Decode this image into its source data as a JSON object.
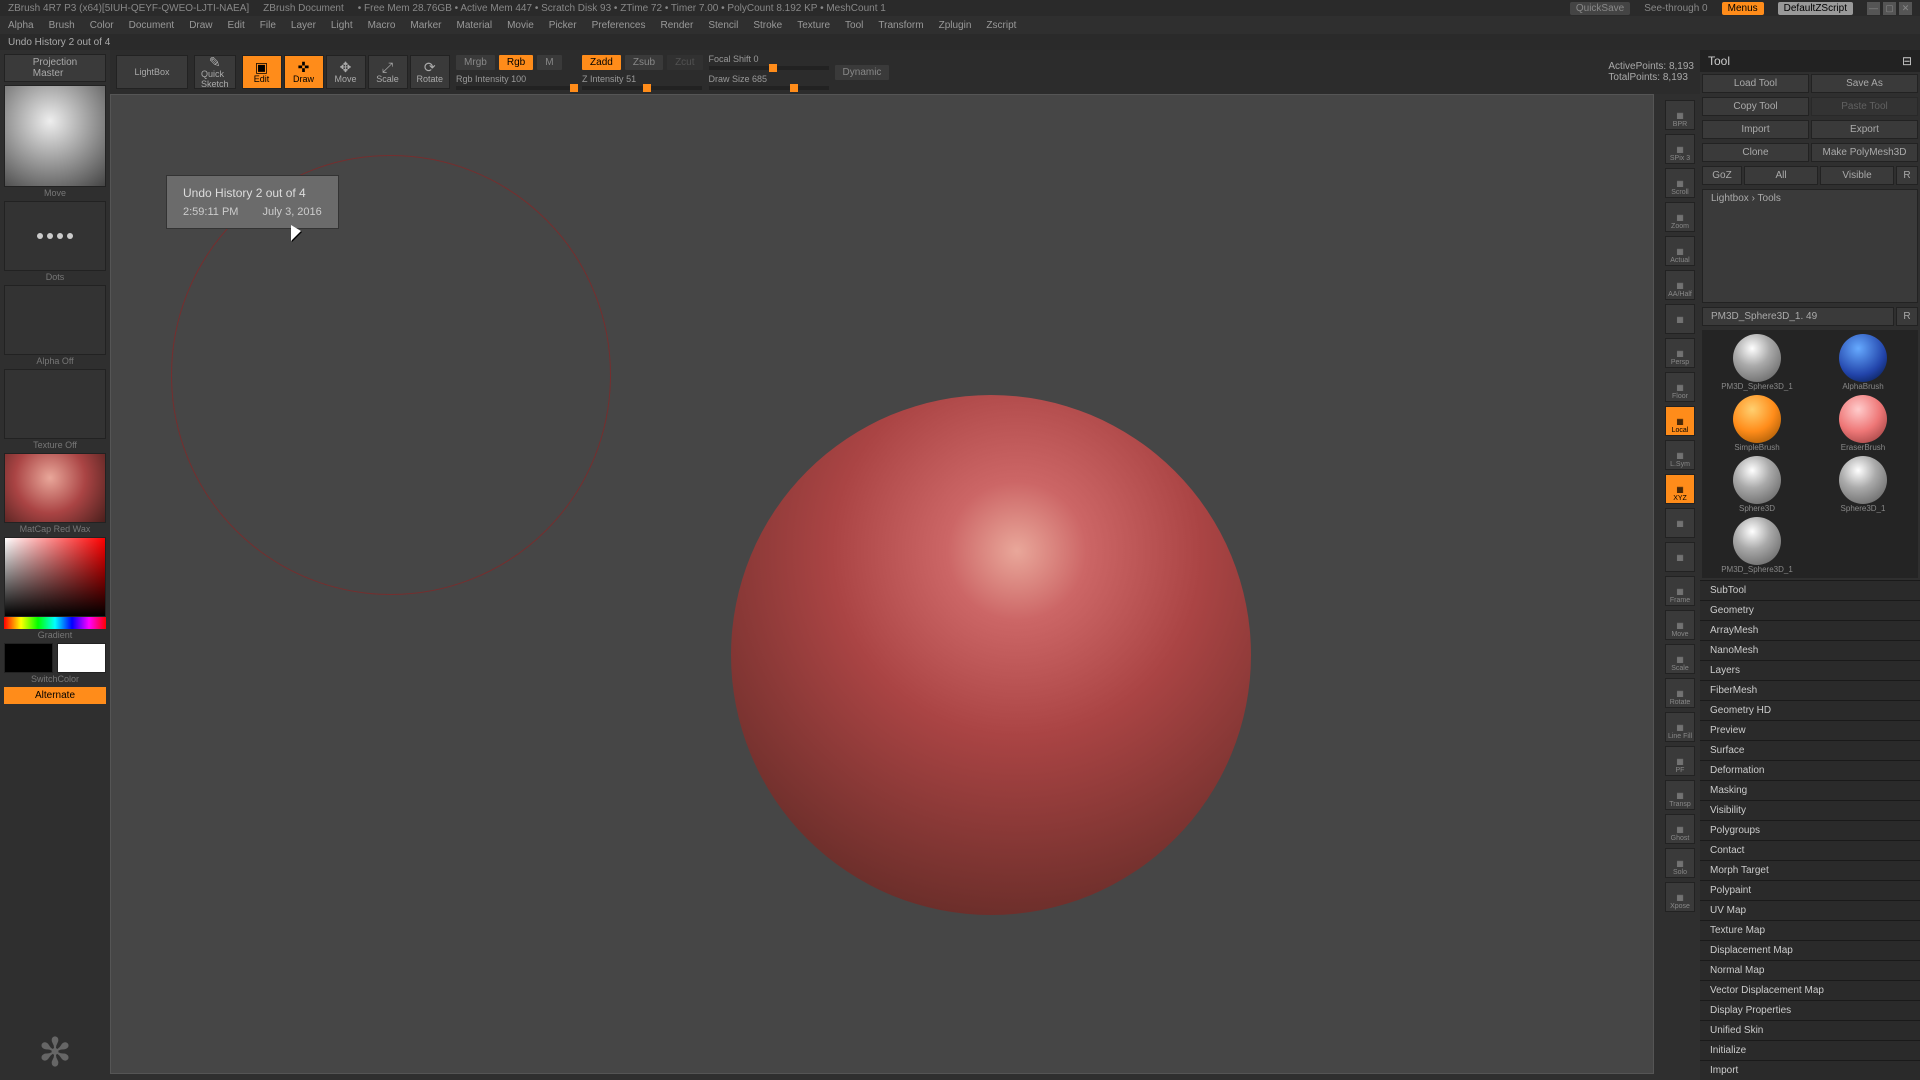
{
  "titlebar": {
    "app": "ZBrush 4R7 P3 (x64)[5IUH-QEYF-QWEO-LJTI-NAEA]",
    "doc": "ZBrush Document",
    "stats": "• Free Mem 28.76GB • Active Mem 447 • Scratch Disk 93 • ZTime 72 • Timer 7.00 • PolyCount 8.192 KP • MeshCount 1",
    "quicksave": "QuickSave",
    "seethrough": "See-through  0",
    "menus": "Menus",
    "script": "DefaultZScript"
  },
  "menubar": [
    "Alpha",
    "Brush",
    "Color",
    "Document",
    "Draw",
    "Edit",
    "File",
    "Layer",
    "Light",
    "Macro",
    "Marker",
    "Material",
    "Movie",
    "Picker",
    "Preferences",
    "Render",
    "Stencil",
    "Stroke",
    "Texture",
    "Tool",
    "Transform",
    "Zplugin",
    "Zscript"
  ],
  "undoline": "Undo History 2 out of 4",
  "left": {
    "proj": "Projection\nMaster",
    "lightbox": "LightBox",
    "brush_lbl": "Move",
    "stroke_lbl": "Dots",
    "alpha_lbl": "Alpha Off",
    "texture_lbl": "Texture Off",
    "material_lbl": "MatCap Red Wax",
    "gradient": "Gradient",
    "switchcolor": "SwitchColor",
    "alternate": "Alternate"
  },
  "topbar": {
    "quicksketch": "Quick\nSketch",
    "edit": "Edit",
    "draw": "Draw",
    "move": "Move",
    "scale": "Scale",
    "rotate": "Rotate",
    "mrgb": "Mrgb",
    "rgb": "Rgb",
    "m": "M",
    "rgb_intensity": "Rgb Intensity 100",
    "zadd": "Zadd",
    "zsub": "Zsub",
    "zcut": "Zcut",
    "z_intensity": "Z Intensity 51",
    "focal_shift": "Focal Shift 0",
    "draw_size": "Draw Size 685",
    "dynamic": "Dynamic",
    "active_points": "ActivePoints: 8,193",
    "total_points": "TotalPoints: 8,193"
  },
  "tooltip": {
    "title": "Undo History 2 out of 4",
    "time": "2:59:11 PM",
    "date": "July 3, 2016"
  },
  "iconstrip": [
    "BPR",
    "SPix 3",
    "Scroll",
    "Zoom",
    "Actual",
    "AA/Half",
    "",
    "Persp",
    "Floor",
    "Local",
    "L.Sym",
    "XYZ",
    "",
    "",
    "Frame",
    "Move",
    "Scale",
    "Rotate",
    "Line Fill",
    "PF",
    "Transp",
    "Ghost",
    "Solo",
    "Xpose"
  ],
  "right": {
    "title": "Tool",
    "buttons": {
      "load": "Load Tool",
      "save": "Save As",
      "copy": "Copy Tool",
      "paste": "Paste Tool",
      "import": "Import",
      "export": "Export",
      "clone": "Clone",
      "polymesh": "Make PolyMesh3D",
      "goz": "GoZ",
      "all": "All",
      "visible": "Visible",
      "r": "R"
    },
    "lightbox_tools": "Lightbox › Tools",
    "current_name": "PM3D_Sphere3D_1. 49",
    "tools": [
      {
        "name": "PM3D_Sphere3D_1",
        "cls": ""
      },
      {
        "name": "AlphaBrush",
        "cls": "alpha"
      },
      {
        "name": "SimpleBrush",
        "cls": "simple"
      },
      {
        "name": "EraserBrush",
        "cls": "eraser"
      },
      {
        "name": "Sphere3D",
        "cls": ""
      },
      {
        "name": "Sphere3D_1",
        "cls": ""
      },
      {
        "name": "PM3D_Sphere3D_1",
        "cls": ""
      }
    ],
    "sections": [
      "SubTool",
      "Geometry",
      "ArrayMesh",
      "NanoMesh",
      "Layers",
      "FiberMesh",
      "Geometry HD",
      "Preview",
      "Surface",
      "Deformation",
      "Masking",
      "Visibility",
      "Polygroups",
      "Contact",
      "Morph Target",
      "Polypaint",
      "UV Map",
      "Texture Map",
      "Displacement Map",
      "Normal Map",
      "Vector Displacement Map",
      "Display Properties",
      "Unified Skin",
      "Initialize",
      "Import"
    ]
  }
}
